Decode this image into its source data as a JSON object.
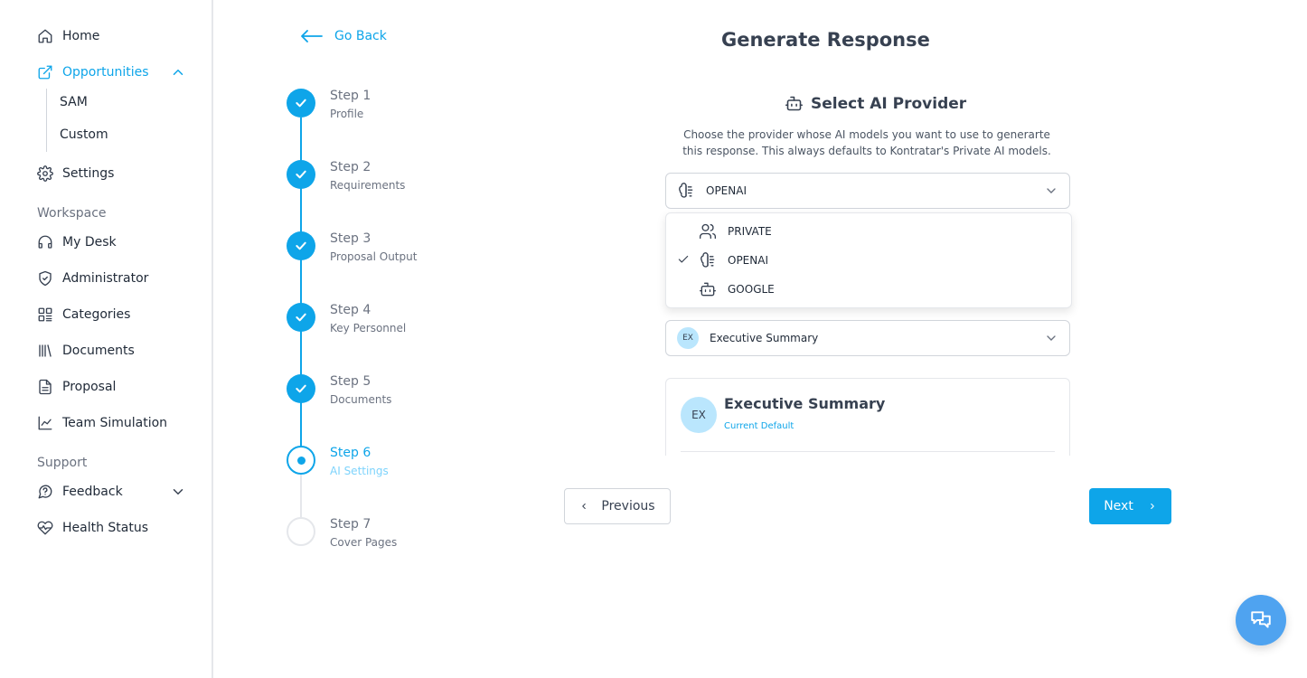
{
  "sidebar": {
    "items": [
      {
        "label": "Home",
        "icon": "home-icon"
      },
      {
        "label": "Opportunities",
        "icon": "external-link-icon",
        "active": true
      },
      {
        "label": "Settings",
        "icon": "gear-icon"
      },
      {
        "label": "My Desk",
        "icon": "headset-icon"
      },
      {
        "label": "Administrator",
        "icon": "shield-icon"
      },
      {
        "label": "Categories",
        "icon": "categories-icon"
      },
      {
        "label": "Documents",
        "icon": "library-icon"
      },
      {
        "label": "Proposal",
        "icon": "document-icon"
      },
      {
        "label": "Team Simulation",
        "icon": "line-chart-icon"
      },
      {
        "label": "Feedback",
        "icon": "message-icon"
      },
      {
        "label": "Health Status",
        "icon": "heart-pulse-icon"
      }
    ],
    "sub_items": [
      "SAM",
      "Custom"
    ],
    "sections": {
      "workspace": "Workspace",
      "support": "Support"
    }
  },
  "header": {
    "go_back": "Go Back",
    "title": "Generate Response"
  },
  "steps": [
    {
      "title": "Step 1",
      "subtitle": "Profile",
      "status": "done"
    },
    {
      "title": "Step 2",
      "subtitle": "Requirements",
      "status": "done"
    },
    {
      "title": "Step 3",
      "subtitle": "Proposal Output",
      "status": "done"
    },
    {
      "title": "Step 4",
      "subtitle": "Key Personnel",
      "status": "done"
    },
    {
      "title": "Step 5",
      "subtitle": "Documents",
      "status": "done"
    },
    {
      "title": "Step 6",
      "subtitle": "AI Settings",
      "status": "current"
    },
    {
      "title": "Step 7",
      "subtitle": "Cover Pages",
      "status": "todo"
    }
  ],
  "provider": {
    "heading": "Select AI Provider",
    "description": "Choose the provider whose AI models you want to use to generarte this response. This always defaults to Kontratar's Private AI models.",
    "selected": "OPENAI",
    "options": [
      {
        "label": "PRIVATE",
        "icon": "users-icon"
      },
      {
        "label": "OPENAI",
        "icon": "brain-icon",
        "checked": true
      },
      {
        "label": "GOOGLE",
        "icon": "bot-icon"
      }
    ]
  },
  "template_select": {
    "badge": "EX",
    "selected": "Executive Summary"
  },
  "summary_card": {
    "avatar": "EX",
    "title": "Executive Summary",
    "subtitle": "Current Default"
  },
  "actions": {
    "previous": "Previous",
    "next": "Next"
  },
  "colors": {
    "accent": "#0ea5e9",
    "chat_fab": "#4fa3f0"
  }
}
